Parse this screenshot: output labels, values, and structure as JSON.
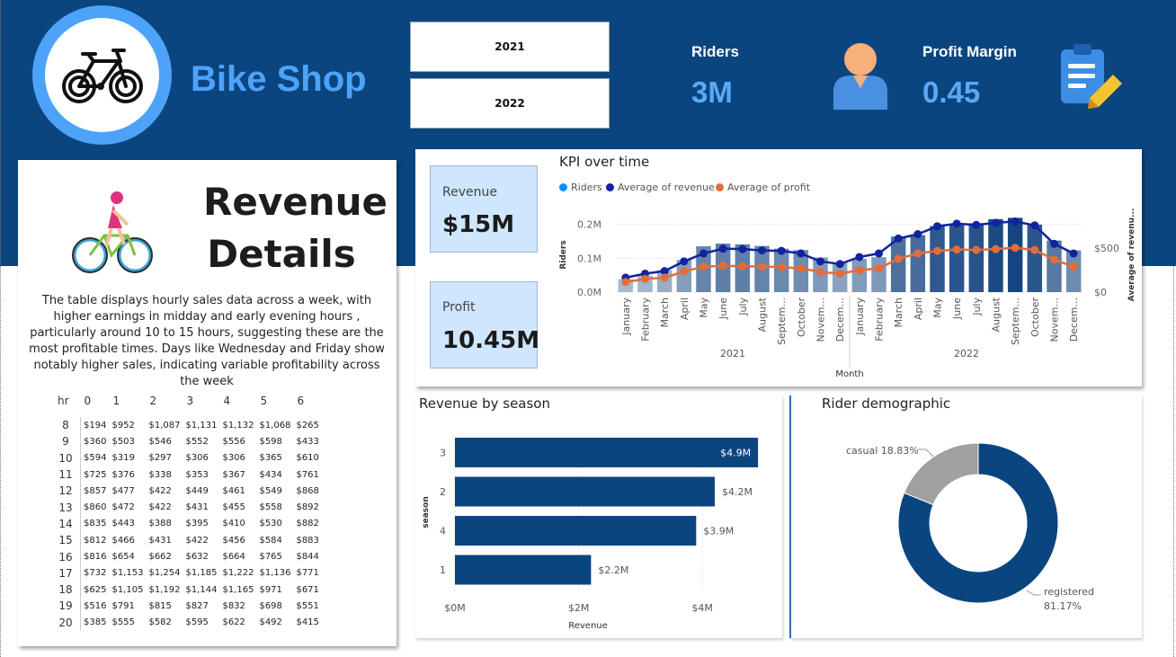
{
  "header": {
    "brand": "Bike Shop",
    "years": [
      "2021",
      "2022"
    ],
    "kpis": [
      {
        "label": "Riders",
        "value": "3M",
        "icon": "user-icon"
      },
      {
        "label": "Profit Margin",
        "value": "0.45",
        "icon": "clipboard-edit-icon"
      }
    ],
    "colors": {
      "banner": "#0b4580",
      "accent": "#4da3f7"
    }
  },
  "revenue_details": {
    "title_line1": "Revenue",
    "title_line2": "Details",
    "icon": "cyclist-icon",
    "description": "The table displays hourly sales data across a week, with higher earnings in midday and early evening hours , particularly around 10 to 15 hours, suggesting these are the most profitable times. Days like Wednesday and Friday show notably higher sales, indicating variable profitability across the week",
    "table": {
      "columns": [
        "hr",
        "0",
        "1",
        "2",
        "3",
        "4",
        "5",
        "6"
      ],
      "rows": [
        [
          "8",
          "$194",
          "$952",
          "$1,087",
          "$1,131",
          "$1,132",
          "$1,068",
          "$265"
        ],
        [
          "9",
          "$360",
          "$503",
          "$546",
          "$552",
          "$556",
          "$598",
          "$433"
        ],
        [
          "10",
          "$594",
          "$319",
          "$297",
          "$306",
          "$306",
          "$365",
          "$610"
        ],
        [
          "11",
          "$725",
          "$376",
          "$338",
          "$353",
          "$367",
          "$434",
          "$761"
        ],
        [
          "12",
          "$857",
          "$477",
          "$422",
          "$449",
          "$461",
          "$549",
          "$868"
        ],
        [
          "13",
          "$860",
          "$472",
          "$422",
          "$431",
          "$455",
          "$558",
          "$892"
        ],
        [
          "14",
          "$835",
          "$443",
          "$388",
          "$395",
          "$410",
          "$530",
          "$882"
        ],
        [
          "15",
          "$812",
          "$466",
          "$431",
          "$422",
          "$456",
          "$584",
          "$883"
        ],
        [
          "16",
          "$816",
          "$654",
          "$662",
          "$632",
          "$664",
          "$765",
          "$844"
        ],
        [
          "17",
          "$732",
          "$1,153",
          "$1,254",
          "$1,185",
          "$1,222",
          "$1,136",
          "$771"
        ],
        [
          "18",
          "$625",
          "$1,105",
          "$1,192",
          "$1,144",
          "$1,165",
          "$971",
          "$671"
        ],
        [
          "19",
          "$516",
          "$791",
          "$815",
          "$827",
          "$832",
          "$698",
          "$551"
        ],
        [
          "20",
          "$385",
          "$555",
          "$582",
          "$595",
          "$622",
          "$492",
          "$415"
        ]
      ]
    }
  },
  "cards": {
    "revenue": {
      "label": "Revenue",
      "value": "$15M"
    },
    "profit": {
      "label": "Profit",
      "value": "10.45M"
    }
  },
  "kpi_over_time": {
    "title": "KPI over time"
  },
  "revenue_by_season": {
    "title": "Revenue by season"
  },
  "rider_demographic": {
    "title": "Rider demographic"
  },
  "chart_data": [
    {
      "type": "bar",
      "title": "KPI over time",
      "legend": [
        "Riders",
        "Average of revenue",
        "Average of profit"
      ],
      "legend_position": "top-left",
      "colors": {
        "riders": "#118dff",
        "revenue": "#12239e",
        "profit": "#e66c37"
      },
      "categories": [
        "January",
        "February",
        "March",
        "April",
        "May",
        "June",
        "July",
        "August",
        "September",
        "October",
        "November",
        "December",
        "January",
        "February",
        "March",
        "April",
        "May",
        "June",
        "July",
        "August",
        "September",
        "October",
        "November",
        "December"
      ],
      "category_labels": [
        "January",
        "February",
        "March",
        "April",
        "May",
        "June",
        "July",
        "August",
        "Septem...",
        "October",
        "Novem...",
        "Decem...",
        "January",
        "February",
        "March",
        "April",
        "May",
        "June",
        "July",
        "August",
        "Septem...",
        "October",
        "Novem...",
        "Decem..."
      ],
      "groups": [
        "2021",
        "2022"
      ],
      "xlabel": "Month",
      "ylabel": "Riders",
      "y2label": "Average of revenu...",
      "ylim": [
        0,
        220000
      ],
      "yticks": [
        "0.0M",
        "0.1M",
        "0.2M"
      ],
      "y2lim": [
        0,
        850
      ],
      "y2ticks": [
        "$0",
        "$500"
      ],
      "series": [
        {
          "name": "Riders",
          "values": [
            38000,
            49000,
            65000,
            95000,
            135000,
            143000,
            141000,
            136000,
            128000,
            124000,
            102000,
            87000,
            98000,
            103000,
            164000,
            168000,
            195000,
            199000,
            203000,
            215000,
            219000,
            199000,
            152000,
            123000
          ]
        },
        {
          "name": "Average of revenue",
          "values": [
            165,
            210,
            240,
            350,
            440,
            495,
            490,
            475,
            470,
            440,
            350,
            320,
            400,
            440,
            610,
            660,
            750,
            780,
            765,
            790,
            805,
            760,
            550,
            440
          ]
        },
        {
          "name": "Average of profit",
          "values": [
            115,
            150,
            165,
            235,
            290,
            300,
            295,
            290,
            285,
            270,
            230,
            210,
            250,
            270,
            380,
            440,
            470,
            485,
            480,
            490,
            505,
            480,
            370,
            290
          ]
        }
      ]
    },
    {
      "type": "bar",
      "title": "Revenue by season",
      "orientation": "horizontal",
      "categories": [
        "3",
        "2",
        "4",
        "1"
      ],
      "values": [
        4.9,
        4.2,
        3.9,
        2.2
      ],
      "data_labels": [
        "$4.9M",
        "$4.2M",
        "$3.9M",
        "$2.2M"
      ],
      "xlabel": "Revenue",
      "ylabel": "season",
      "xlim": [
        0,
        5
      ],
      "xticks": [
        "$0M",
        "$2M",
        "$4M"
      ],
      "color": "#0b4580"
    },
    {
      "type": "pie",
      "title": "Rider demographic",
      "donut": true,
      "labels": [
        "registered",
        "casual"
      ],
      "values": [
        81.17,
        18.83
      ],
      "data_labels": [
        "registered 81.17%",
        "casual 18.83%"
      ],
      "colors": [
        "#0b4580",
        "#a0a0a0"
      ]
    }
  ]
}
